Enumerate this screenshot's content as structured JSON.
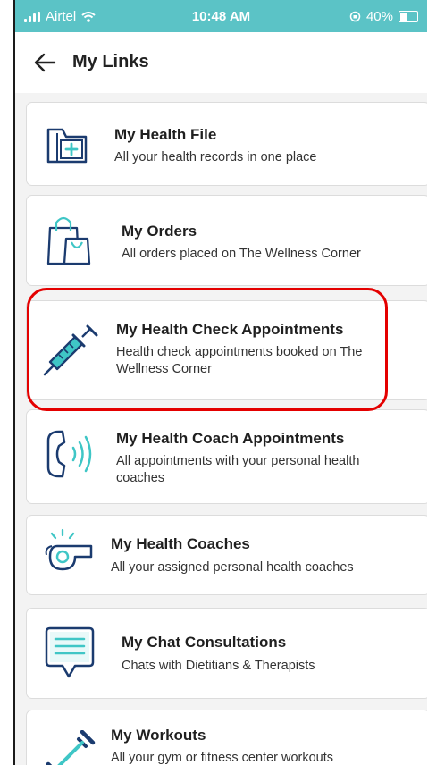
{
  "status_bar": {
    "carrier": "Airtel",
    "time": "10:48 AM",
    "battery": "40%"
  },
  "header": {
    "title": "My Links",
    "back_icon": "arrow-left-icon"
  },
  "links": [
    {
      "title": "My Health File",
      "description": "All your health records in one place",
      "icon": "health-file-folder-icon"
    },
    {
      "title": "My Orders",
      "description": "All orders placed on The Wellness Corner",
      "icon": "shopping-bags-icon"
    },
    {
      "title": "My Health Check Appointments",
      "description": "Health check appointments booked on The Wellness Corner",
      "icon": "syringe-icon"
    },
    {
      "title": "My Health Coach Appointments",
      "description": "All appointments with your personal health coaches",
      "icon": "phone-ringing-icon"
    },
    {
      "title": "My Health Coaches",
      "description": "All your assigned personal health coaches",
      "icon": "whistle-icon"
    },
    {
      "title": "My Chat Consultations",
      "description": "Chats with Dietitians & Therapists",
      "icon": "chat-bubble-icon"
    },
    {
      "title": "My Workouts",
      "description": "All your gym or fitness center workouts",
      "icon": "dumbbell-icon"
    }
  ],
  "colors": {
    "status_bar": "#5bc3c6",
    "icon_stroke": "#1b3b6f",
    "icon_accent": "#3fc6c6",
    "highlight": "#e40000"
  }
}
